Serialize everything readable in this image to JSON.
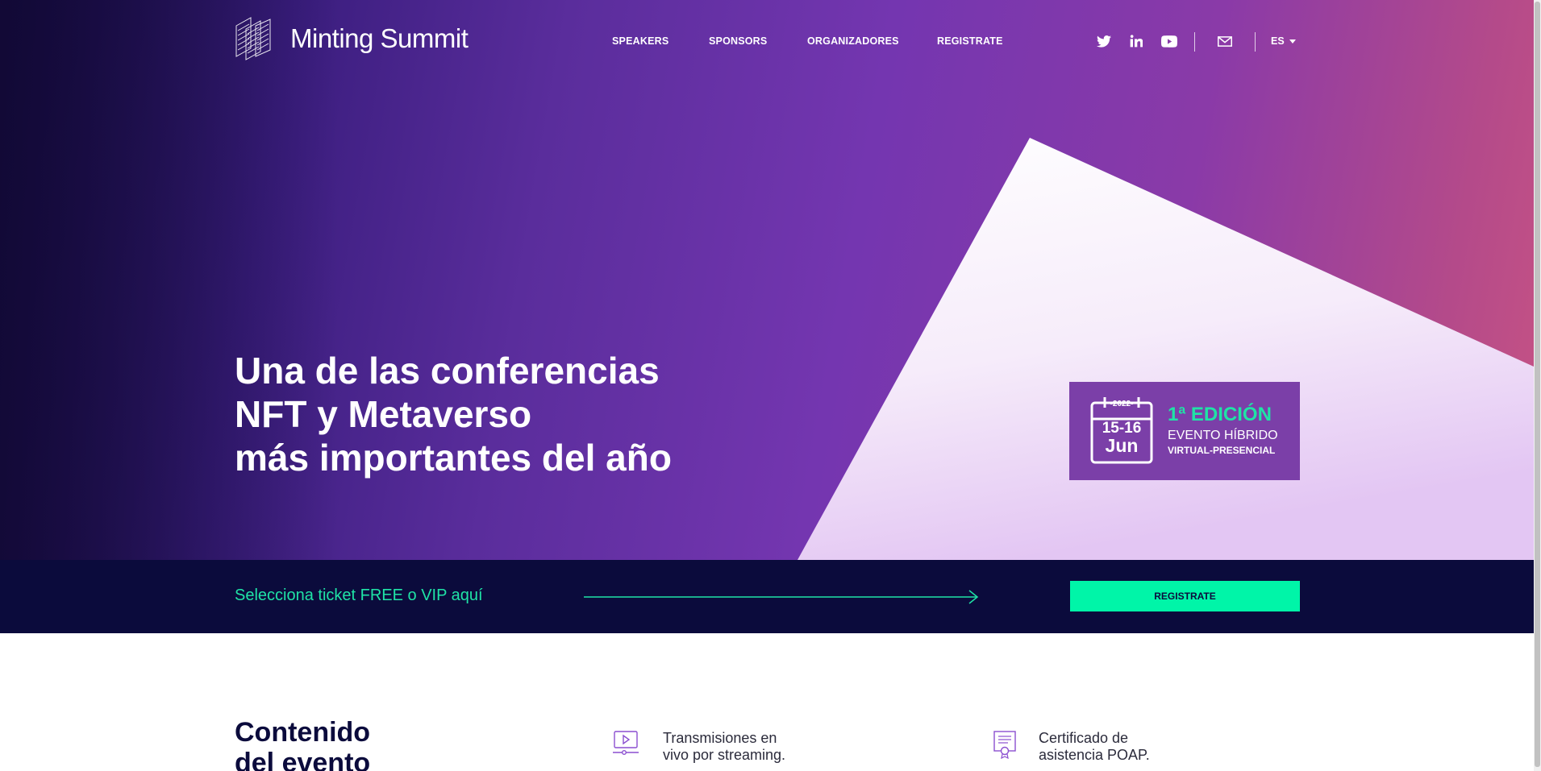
{
  "brand": {
    "name": "Minting Summit"
  },
  "nav": {
    "items": [
      {
        "label": "SPEAKERS"
      },
      {
        "label": "SPONSORS"
      },
      {
        "label": "ORGANIZADORES"
      },
      {
        "label": "REGISTRATE"
      }
    ]
  },
  "social": {
    "icons": [
      "twitter-icon",
      "linkedin-icon",
      "youtube-icon",
      "mail-icon"
    ]
  },
  "language": {
    "current": "ES"
  },
  "hero": {
    "line1": "Una de las conferencias",
    "line2": "NFT y Metaverso",
    "line3": "más importantes del año"
  },
  "badge": {
    "year": "-2022-",
    "days": "15-16",
    "month": "Jun",
    "edition": "1ª EDICIÓN",
    "event_type": "EVENTO HÍBRIDO",
    "modality": "VIRTUAL-PRESENCIAL"
  },
  "cta": {
    "text": "Selecciona ticket FREE o VIP aquí",
    "button_label": "REGISTRATE"
  },
  "content": {
    "title_line1": "Contenido",
    "title_line2": "del evento",
    "features": [
      {
        "icon": "video-play-icon",
        "line1": "Transmisiones en",
        "line2": "vivo por streaming."
      },
      {
        "icon": "certificate-icon",
        "line1": "Certificado de",
        "line2": "asistencia POAP."
      }
    ]
  },
  "colors": {
    "accent": "#00f5a8",
    "accent_text": "#1fe3a6",
    "navy": "#0b0b3c",
    "badge_bg": "#7b3fa8"
  }
}
